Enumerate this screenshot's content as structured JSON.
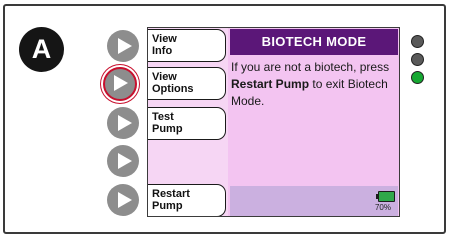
{
  "panel_label": "A",
  "menu": {
    "items": [
      {
        "line1": "View",
        "line2": "Info"
      },
      {
        "line1": "View",
        "line2": "Options"
      },
      {
        "line1": "Test",
        "line2": "Pump"
      },
      {
        "line1": "Restart",
        "line2": "Pump"
      }
    ]
  },
  "screen": {
    "title": "BIOTECH MODE",
    "message_part1": "If you are not a biotech, press ",
    "message_bold": "Restart Pump",
    "message_part2": " to exit Biotech Mode."
  },
  "status": {
    "battery_percent": "70%",
    "battery_level": 0.7,
    "battery_icon": "battery-icon"
  },
  "indicator_lights": [
    {
      "name": "led-1",
      "color": "#5a5a5a"
    },
    {
      "name": "led-2",
      "color": "#5a5a5a"
    },
    {
      "name": "led-3",
      "color": "#16a832"
    }
  ],
  "colors": {
    "header": "#5b1778",
    "screen_bg": "#f3c4f1",
    "status_bar": "#cbb0e0",
    "selected_button_ring": "#c8102e"
  }
}
